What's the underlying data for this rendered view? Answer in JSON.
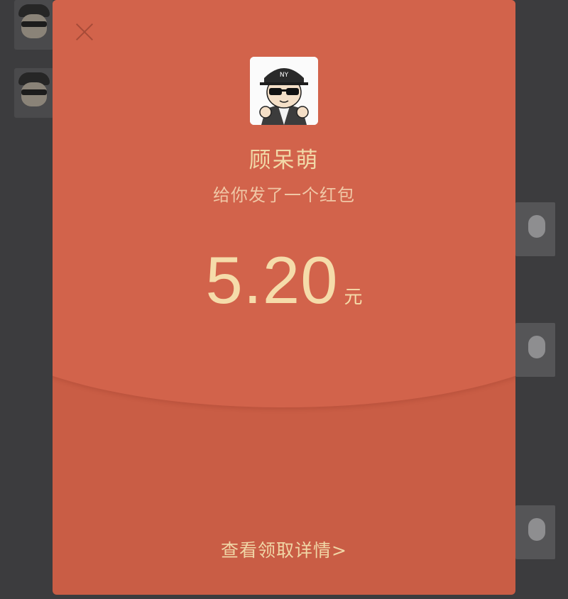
{
  "background_chat": {
    "avatar_icon_name": "sender-avatar-icon",
    "thumbnail_icon_name": "photo-thumbnail-icon"
  },
  "red_packet": {
    "close_icon": "close-icon",
    "avatar_icon": "cartoon-avatar-icon",
    "sender_name": "顾呆萌",
    "greeting": "给你发了一个红包",
    "amount": "5.20",
    "currency": "元",
    "detail_link": "查看领取详情",
    "detail_chevron": ">"
  },
  "colors": {
    "packet_red": "#c95d45",
    "packet_top_red": "#d2634b",
    "gold_text": "#f1d9a8",
    "overlay": "#3c3c3e"
  }
}
